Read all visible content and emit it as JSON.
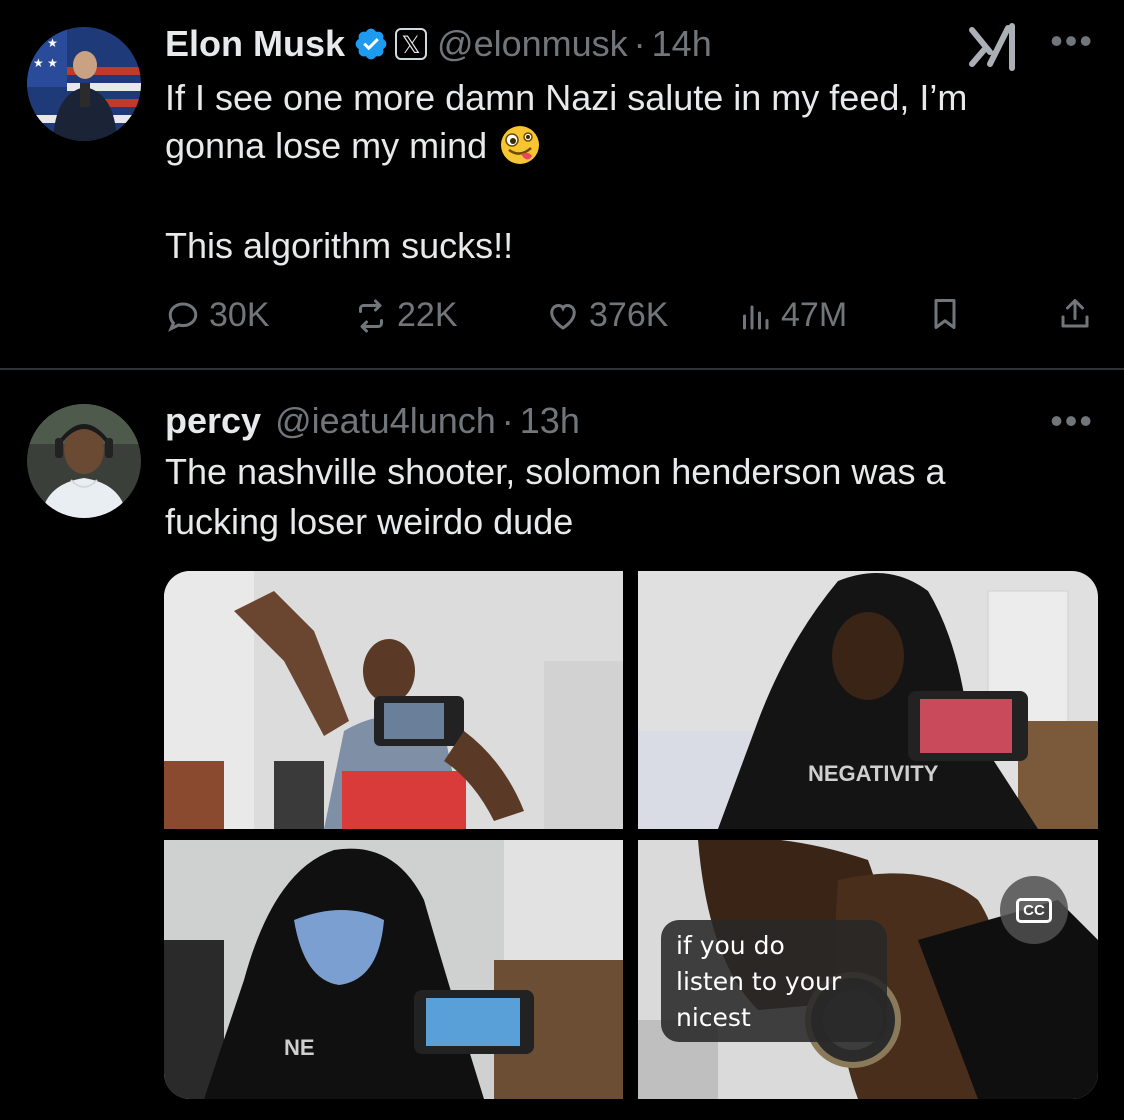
{
  "tweet1": {
    "name": "Elon Musk",
    "badge": "𝕏",
    "handle": "@elonmusk",
    "separator": "·",
    "time": "14h",
    "more": "•••",
    "lines": [
      "If I see one more damn Nazi salute in my feed, I’m",
      "gonna lose my mind",
      "This algorithm sucks!!"
    ],
    "emoji_icon": "zany-face-emoji",
    "stats": {
      "replies": "30K",
      "reposts": "22K",
      "likes": "376K",
      "views": "47M"
    },
    "verified_color": "#1d9bf0"
  },
  "tweet2": {
    "name": "percy",
    "handle": "@ieatu4lunch",
    "separator": "·",
    "time": "13h",
    "more": "•••",
    "lines": [
      "The nashville shooter, solomon henderson was a",
      "fucking loser weirdo dude"
    ],
    "media": {
      "cc_label": "CC",
      "caption_lines": [
        " if you do",
        "listen to your",
        "nicest"
      ],
      "tile_texts": [
        "NEGATIVITY",
        "NE"
      ]
    }
  },
  "colors": {
    "background": "#000000",
    "text": "#e7e9ea",
    "muted": "#71767b",
    "divider": "#2f3336"
  }
}
